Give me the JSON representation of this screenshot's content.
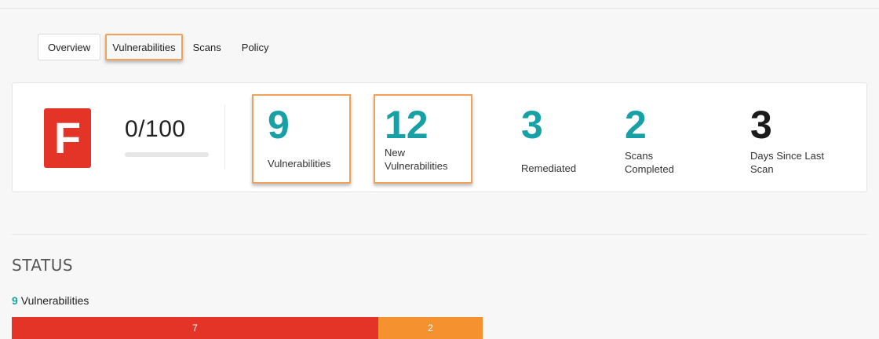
{
  "tabs": [
    {
      "label": "Overview"
    },
    {
      "label": "Vulnerabilities"
    },
    {
      "label": "Scans"
    },
    {
      "label": "Policy"
    }
  ],
  "summary": {
    "grade": "F",
    "score_text": "0/100",
    "score_fraction": 0.0,
    "stats": [
      {
        "value": "9",
        "label": "Vulnerabilities"
      },
      {
        "value": "12",
        "label_line1": "New",
        "label_line2": "Vulnerabilities"
      },
      {
        "value": "3",
        "label": "Remediated"
      },
      {
        "value": "2",
        "label_line1": "Scans",
        "label_line2": "Completed"
      },
      {
        "value": "3",
        "label_line1": "Days Since Last",
        "label_line2": "Scan"
      }
    ]
  },
  "status": {
    "title": "STATUS",
    "count": "9",
    "count_label": "Vulnerabilities",
    "segments": [
      {
        "value": "7",
        "color": "#e33427"
      },
      {
        "value": "2",
        "color": "#f5922f"
      }
    ]
  },
  "colors": {
    "accent": "#17a0a6",
    "danger": "#e33427",
    "warning": "#f5922f",
    "highlight_border": "#f0a25a"
  }
}
